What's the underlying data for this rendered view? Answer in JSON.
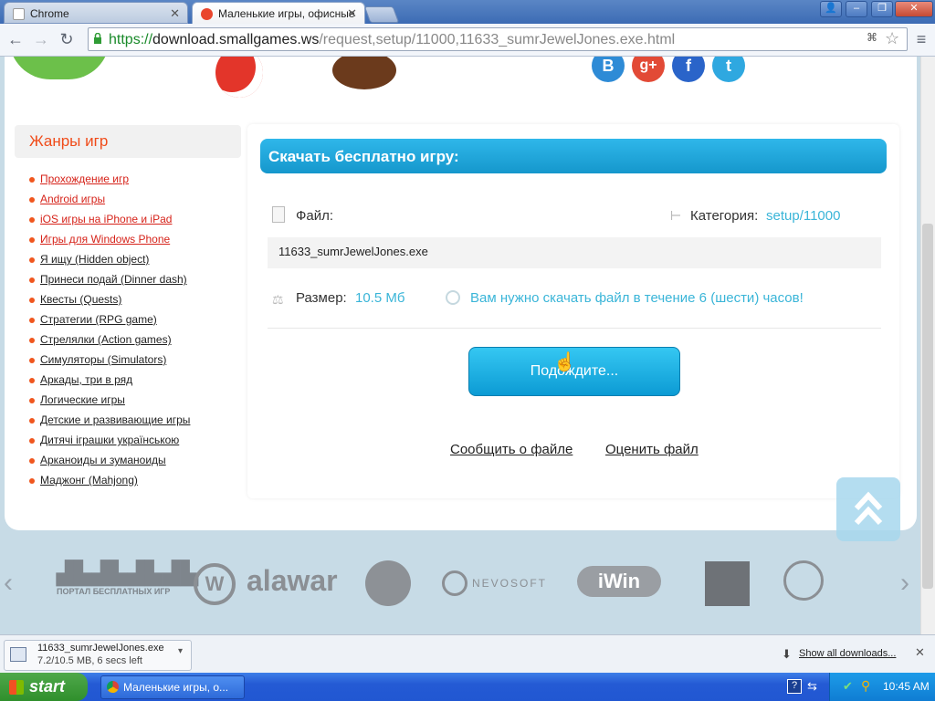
{
  "browser": {
    "tabs": [
      {
        "label": "Chrome"
      },
      {
        "label": "Маленькие игры, офисные"
      }
    ],
    "url_scheme": "https://",
    "url_host": "download.smallgames.ws",
    "url_path": "/request,setup/11000,11633_sumrJewelJones.exe.html"
  },
  "social": [
    "B",
    "g+",
    "f",
    "t"
  ],
  "sidebar": {
    "title": "Жанры игр",
    "items": [
      "Прохождение игр",
      "Android игры",
      "iOS игры на iPhone и iPad",
      "Игры для Windows Phone",
      "Я ищу (Hidden object)",
      "Принеси подай (Dinner dash)",
      "Квесты (Quests)",
      "Стратегии (RPG game)",
      "Стрелялки (Action games)",
      "Симуляторы (Simulators)",
      "Аркады, три в ряд",
      "Логические игры",
      "Детские и развивающие игры",
      "Дитячі іграшки українською",
      "Арканоиды и зуманоиды",
      "Маджонг (Mahjong)"
    ]
  },
  "download": {
    "header": "Скачать бесплатно игру:",
    "file_label": "Файл:",
    "category_label": "Категория:",
    "category_value": "setup/11000",
    "file_name": "11633_sumrJewelJones.exe",
    "size_label": "Размер:",
    "size_value": "10.5 Мб",
    "deadline_text": "Вам нужно скачать файл в течение 6 (шести) часов!",
    "wait_button": "Подождите...",
    "report_link": "Сообщить о файле",
    "rate_link": "Оценить файл"
  },
  "partners": [
    "ПОРТАЛ БЕСПЛАТНЫХ ИГР",
    "alawar",
    "NEVOSOFT",
    "iWin"
  ],
  "shelf": {
    "file_name": "11633_sumrJewelJones.exe",
    "progress_text": "7.2/10.5 MB, 6 secs left",
    "show_all": "Show all downloads..."
  },
  "taskbar": {
    "start": "start",
    "task_item": "Маленькие игры, о...",
    "clock": "10:45 AM"
  },
  "colors": {
    "accent": "#1ea6db",
    "sidebar_title": "#f04c1a",
    "link_red": "#d6231a",
    "teal_text": "#3ab5d8"
  }
}
